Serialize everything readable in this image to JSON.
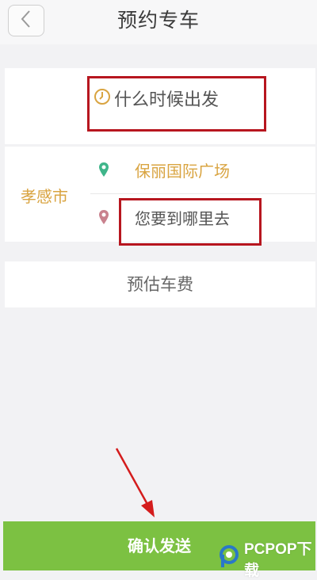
{
  "header": {
    "title": "预约专车",
    "back_icon": "chevron-left-icon"
  },
  "trip": {
    "time_placeholder": "什么时候出发",
    "city": "孝感市",
    "start_location": "保丽国际广场",
    "destination_placeholder": "您要到哪里去"
  },
  "fare": {
    "label": "预估车费"
  },
  "footer": {
    "confirm_label": "确认发送"
  },
  "watermark": {
    "text": "PCPOP下载"
  },
  "colors": {
    "accent_green": "#7cc142",
    "highlight_red": "#b7161f",
    "gold": "#d9a441",
    "start_pin": "#3fb58a",
    "end_pin": "#c9828e"
  },
  "icons": [
    "chevron-left-icon",
    "clock-icon",
    "start-pin-icon",
    "destination-pin-icon",
    "red-arrow-icon"
  ]
}
